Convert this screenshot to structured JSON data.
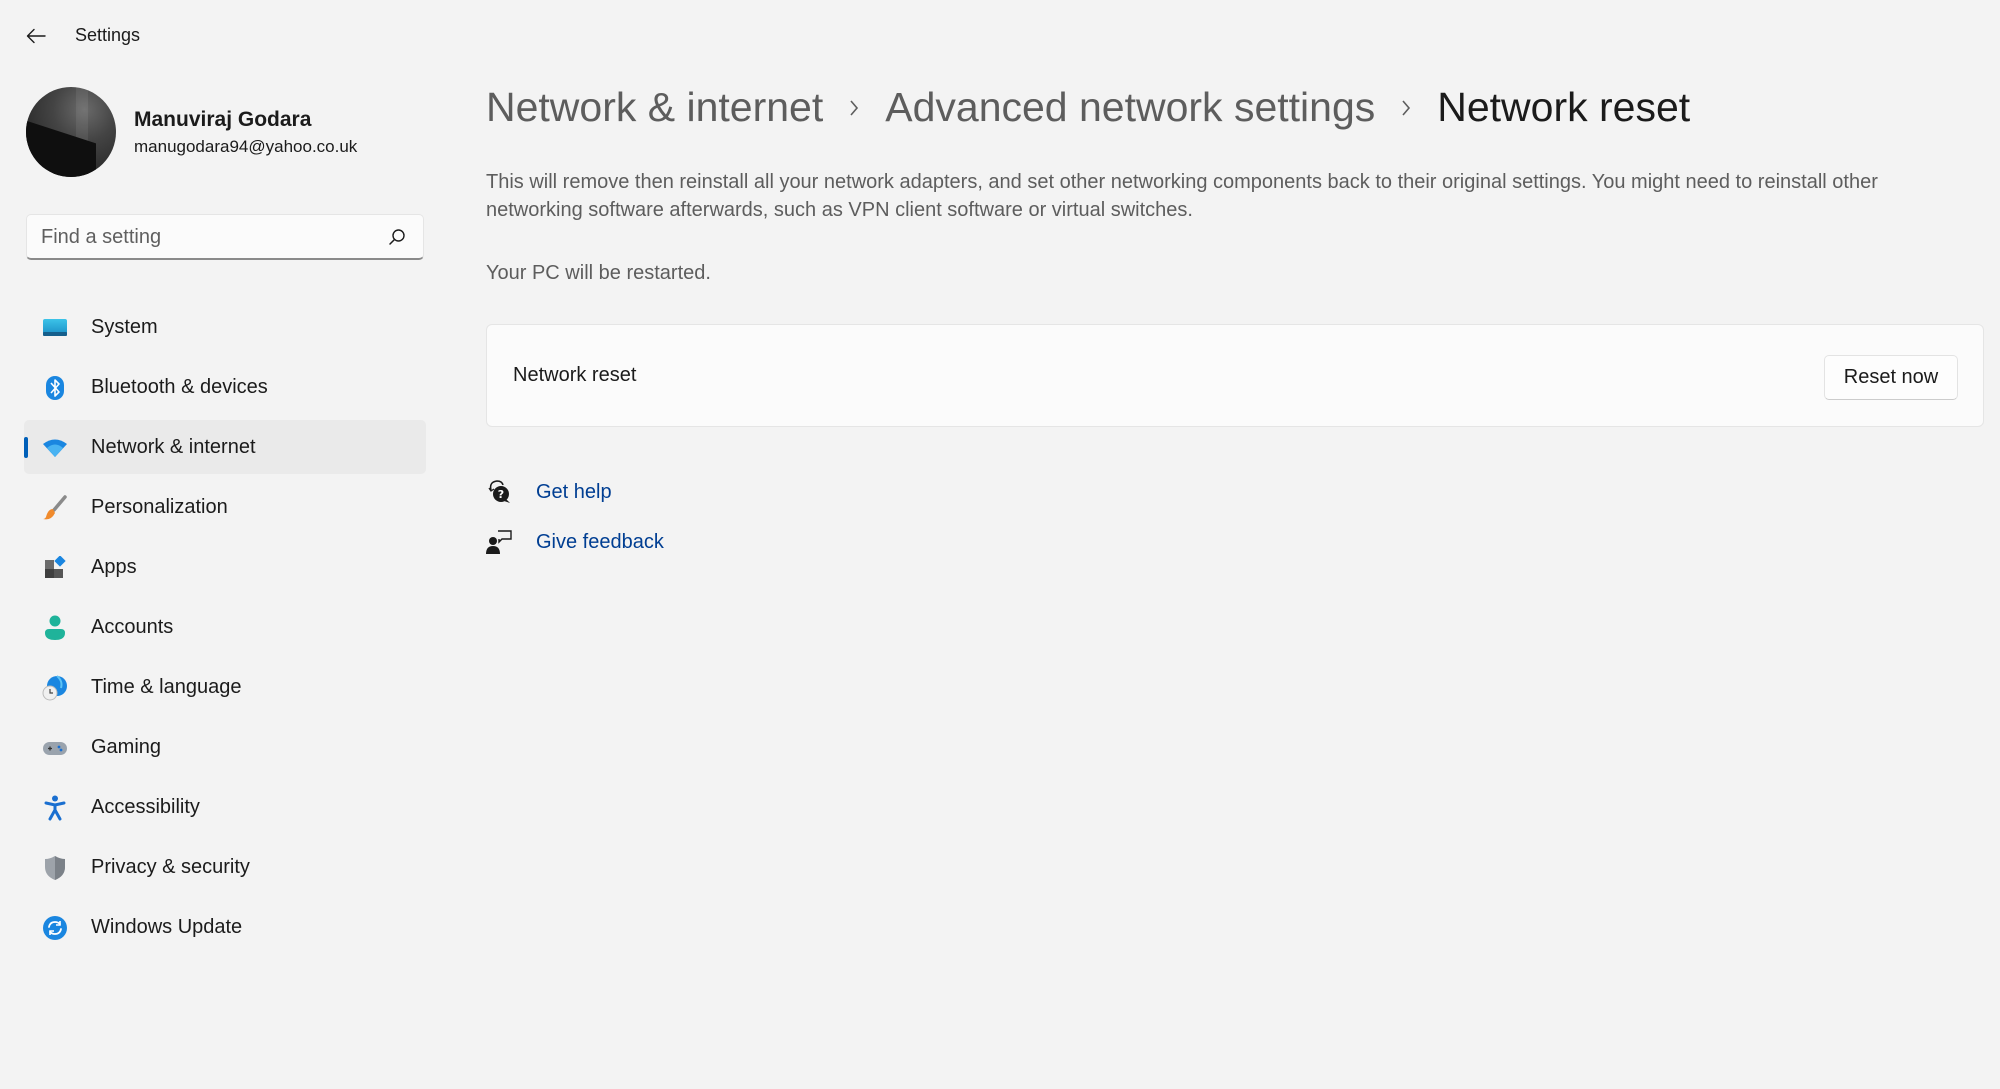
{
  "window": {
    "title": "Settings",
    "back_icon": "arrow-left-icon"
  },
  "profile": {
    "name": "Manuviraj Godara",
    "email": "manugodara94@yahoo.co.uk"
  },
  "search": {
    "placeholder": "Find a setting",
    "value": "",
    "icon": "search-icon"
  },
  "sidebar": {
    "active_index": 2,
    "accent": "#005fb8",
    "items": [
      {
        "label": "System",
        "icon": "monitor-icon"
      },
      {
        "label": "Bluetooth & devices",
        "icon": "bluetooth-icon"
      },
      {
        "label": "Network & internet",
        "icon": "wifi-icon"
      },
      {
        "label": "Personalization",
        "icon": "paintbrush-icon"
      },
      {
        "label": "Apps",
        "icon": "apps-icon"
      },
      {
        "label": "Accounts",
        "icon": "person-icon"
      },
      {
        "label": "Time & language",
        "icon": "globe-clock-icon"
      },
      {
        "label": "Gaming",
        "icon": "gamepad-icon"
      },
      {
        "label": "Accessibility",
        "icon": "accessibility-icon"
      },
      {
        "label": "Privacy & security",
        "icon": "shield-icon"
      },
      {
        "label": "Windows Update",
        "icon": "refresh-icon"
      }
    ]
  },
  "main": {
    "breadcrumb": [
      {
        "label": "Network & internet"
      },
      {
        "label": "Advanced network settings"
      },
      {
        "label": "Network reset"
      }
    ],
    "description": "This will remove then reinstall all your network adapters, and set other networking components back to their original settings. You might need to reinstall other networking software afterwards, such as VPN client software or virtual switches.",
    "restart_note": "Your PC will be restarted.",
    "card": {
      "label": "Network reset",
      "button_label": "Reset now"
    },
    "links": [
      {
        "label": "Get help",
        "icon": "help-chat-icon"
      },
      {
        "label": "Give feedback",
        "icon": "feedback-icon"
      }
    ],
    "link_color": "#003e92"
  }
}
